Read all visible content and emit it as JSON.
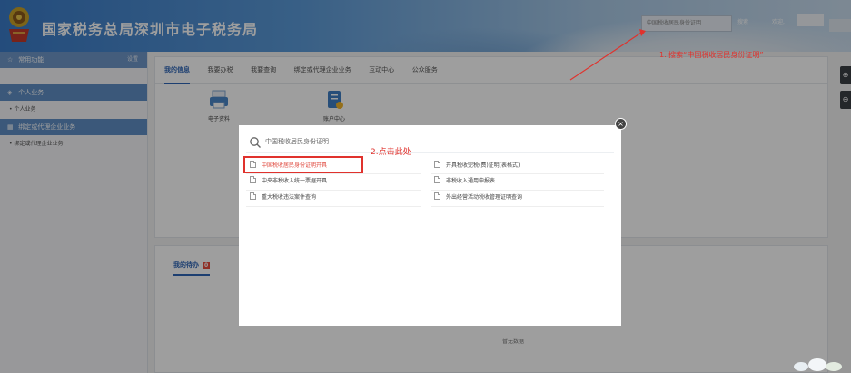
{
  "header": {
    "title": "国家税务总局深圳市电子税务局",
    "search_placeholder": "中国税收居民身份证明",
    "search_button": "搜索",
    "welcome": "欢迎,"
  },
  "sidebar": {
    "common": "常用功能",
    "settings": "设置",
    "dash": "–",
    "groups": [
      {
        "label": "个人业务",
        "sub": "个人业务"
      },
      {
        "label": "绑定或代理企业业务",
        "sub": "绑定或代理企业业务"
      }
    ]
  },
  "tabs": [
    "我的信息",
    "我要办税",
    "我要查询",
    "绑定或代理企业业务",
    "互动中心",
    "公众服务"
  ],
  "apps": [
    {
      "label": "电子资料"
    },
    {
      "label": "账户中心"
    }
  ],
  "todo": {
    "title": "我的待办",
    "badge": "0",
    "empty": "暂无数据"
  },
  "modal": {
    "query": "中国税收居民身份证明",
    "results_left": [
      "中国税收居民身份证明开具",
      "中央非税收入统一票据开具",
      "重大税收违法案件查询"
    ],
    "results_right": [
      "开具税收完税(费)证明(表格式)",
      "非税收入通用申报表",
      "外出经营活动税收管理证明查询"
    ]
  },
  "annotations": {
    "step1": "1. 搜索“中国税收居民身份证明”",
    "step2": "2.点击此处"
  },
  "colors": {
    "accent": "#2f66b6",
    "annotation": "#e0322d",
    "sidebar_group": "#5f8fc6"
  }
}
